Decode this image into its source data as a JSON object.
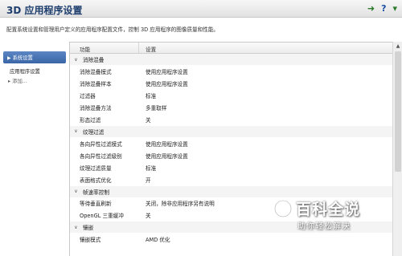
{
  "window": {
    "title": "3D 应用程序设置",
    "icons": [
      "back-icon",
      "help-icon"
    ]
  },
  "description": "配置系统设置和管理用户定义的应用程序配置文件，控制 3D 应用程序的图像质量和性能。",
  "sidebar": {
    "tabs": [
      {
        "label": "系统设置",
        "selected": true
      },
      {
        "label": "应用程序设置",
        "selected": false
      }
    ],
    "add_label": "添加..."
  },
  "grid": {
    "columns": [
      "功能",
      "设置"
    ],
    "groups": [
      {
        "label": "消除混叠",
        "rows": [
          {
            "feature": "消除混叠模式",
            "setting": "使用应用程序设置"
          },
          {
            "feature": "消除混叠样本",
            "setting": "使用应用程序设置"
          },
          {
            "feature": "过滤器",
            "setting": "标准"
          },
          {
            "feature": "消除混叠方法",
            "setting": "多重取样"
          },
          {
            "feature": "形态过滤",
            "setting": "关"
          }
        ]
      },
      {
        "label": "纹理过滤",
        "rows": [
          {
            "feature": "各向异性过滤模式",
            "setting": "使用应用程序设置"
          },
          {
            "feature": "各向异性过滤级别",
            "setting": "使用应用程序设置"
          },
          {
            "feature": "纹理过滤质量",
            "setting": "标准"
          },
          {
            "feature": "表面格式优化",
            "setting": "开"
          }
        ]
      },
      {
        "label": "帧速率控制",
        "rows": [
          {
            "feature": "等待垂直刷新",
            "setting": "关闭，除非应用程序另有说明"
          },
          {
            "feature": "OpenGL 三重缓冲",
            "setting": "关"
          }
        ]
      },
      {
        "label": "镶嵌",
        "rows": [
          {
            "feature": "镶嵌模式",
            "setting": "AMD 优化"
          }
        ]
      }
    ]
  },
  "watermark": {
    "main": "百科全说",
    "sub": "助你轻松解决"
  },
  "colors": {
    "selected_tab": "#4a76b6",
    "title_text": "#1e3f6e",
    "group_background": "#f4f4f4"
  }
}
